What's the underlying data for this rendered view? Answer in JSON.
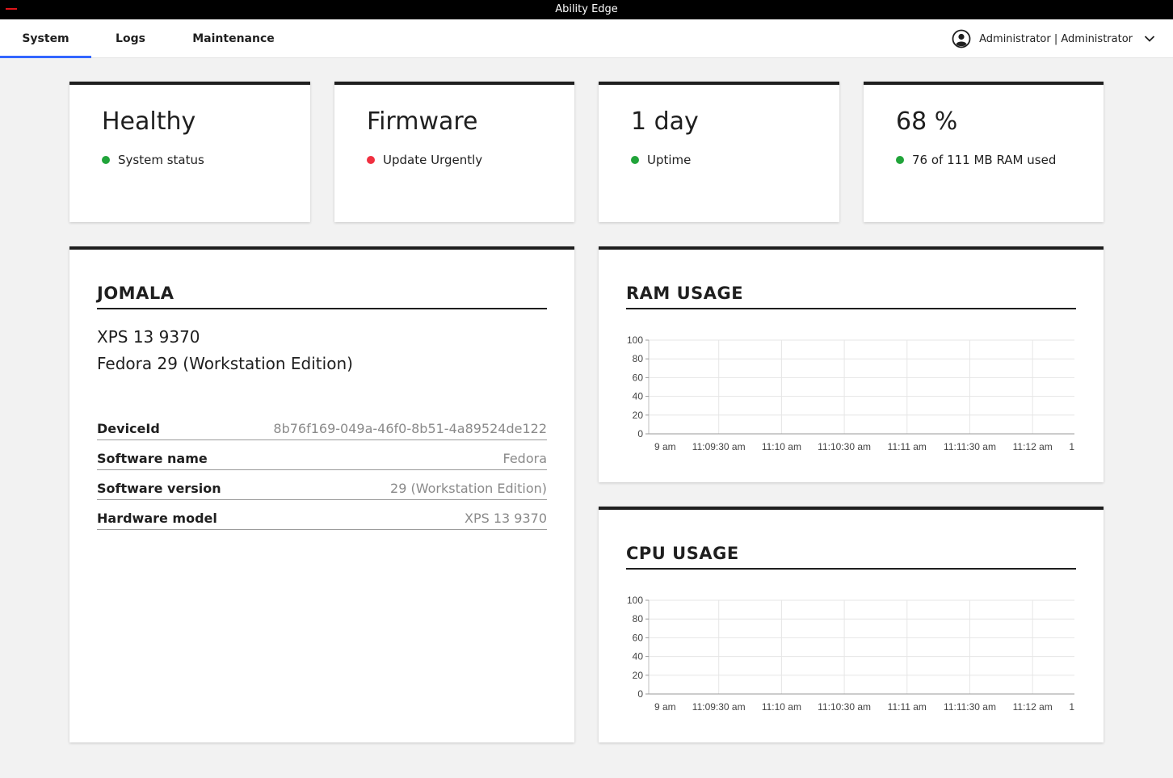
{
  "app": {
    "title": "Ability Edge"
  },
  "nav": {
    "tabs": [
      {
        "label": "System",
        "active": true
      },
      {
        "label": "Logs",
        "active": false
      },
      {
        "label": "Maintenance",
        "active": false
      }
    ],
    "user": {
      "name": "Administrator | Administrator",
      "icon": "user-circle-icon"
    }
  },
  "status_cards": [
    {
      "value": "Healthy",
      "label": "System status",
      "status_color": "#21a43a"
    },
    {
      "value": "Firmware",
      "label": "Update Urgently",
      "status_color": "#f03040"
    },
    {
      "value": "1 day",
      "label": "Uptime",
      "status_color": "#21a43a"
    },
    {
      "value": "68 %",
      "label": "76 of 111 MB RAM used",
      "status_color": "#21a43a"
    }
  ],
  "device": {
    "title": "JOMALA",
    "model_line": "XPS 13 9370",
    "os_line": "Fedora 29 (Workstation Edition)",
    "properties": [
      {
        "key": "DeviceId",
        "value": "8b76f169-049a-46f0-8b51-4a89524de122"
      },
      {
        "key": "Software name",
        "value": "Fedora"
      },
      {
        "key": "Software version",
        "value": "29 (Workstation Edition)"
      },
      {
        "key": "Hardware model",
        "value": "XPS 13 9370"
      }
    ]
  },
  "ram_chart": {
    "title": "RAM USAGE",
    "chart_data": {
      "type": "line",
      "title": "RAM USAGE",
      "yticks": [
        100,
        80,
        60,
        40,
        20,
        0
      ],
      "ylim": [
        0,
        100
      ],
      "xticks": [
        "9 am",
        "11:09:30 am",
        "11:10 am",
        "11:10:30 am",
        "11:11 am",
        "11:11:30 am",
        "11:12 am",
        "1"
      ],
      "series": [],
      "grid": true
    }
  },
  "cpu_chart": {
    "title": "CPU USAGE",
    "chart_data": {
      "type": "line",
      "title": "CPU USAGE",
      "yticks": [
        100,
        80,
        60,
        40,
        20,
        0
      ],
      "ylim": [
        0,
        100
      ],
      "xticks": [
        "9 am",
        "11:09:30 am",
        "11:10 am",
        "11:10:30 am",
        "11:11 am",
        "11:11:30 am",
        "11:12 am",
        "1"
      ],
      "series": [],
      "grid": true
    }
  },
  "colors": {
    "accent": "#3366ff",
    "brand_red": "#e0161b",
    "ok": "#21a43a",
    "alert": "#f03040"
  }
}
